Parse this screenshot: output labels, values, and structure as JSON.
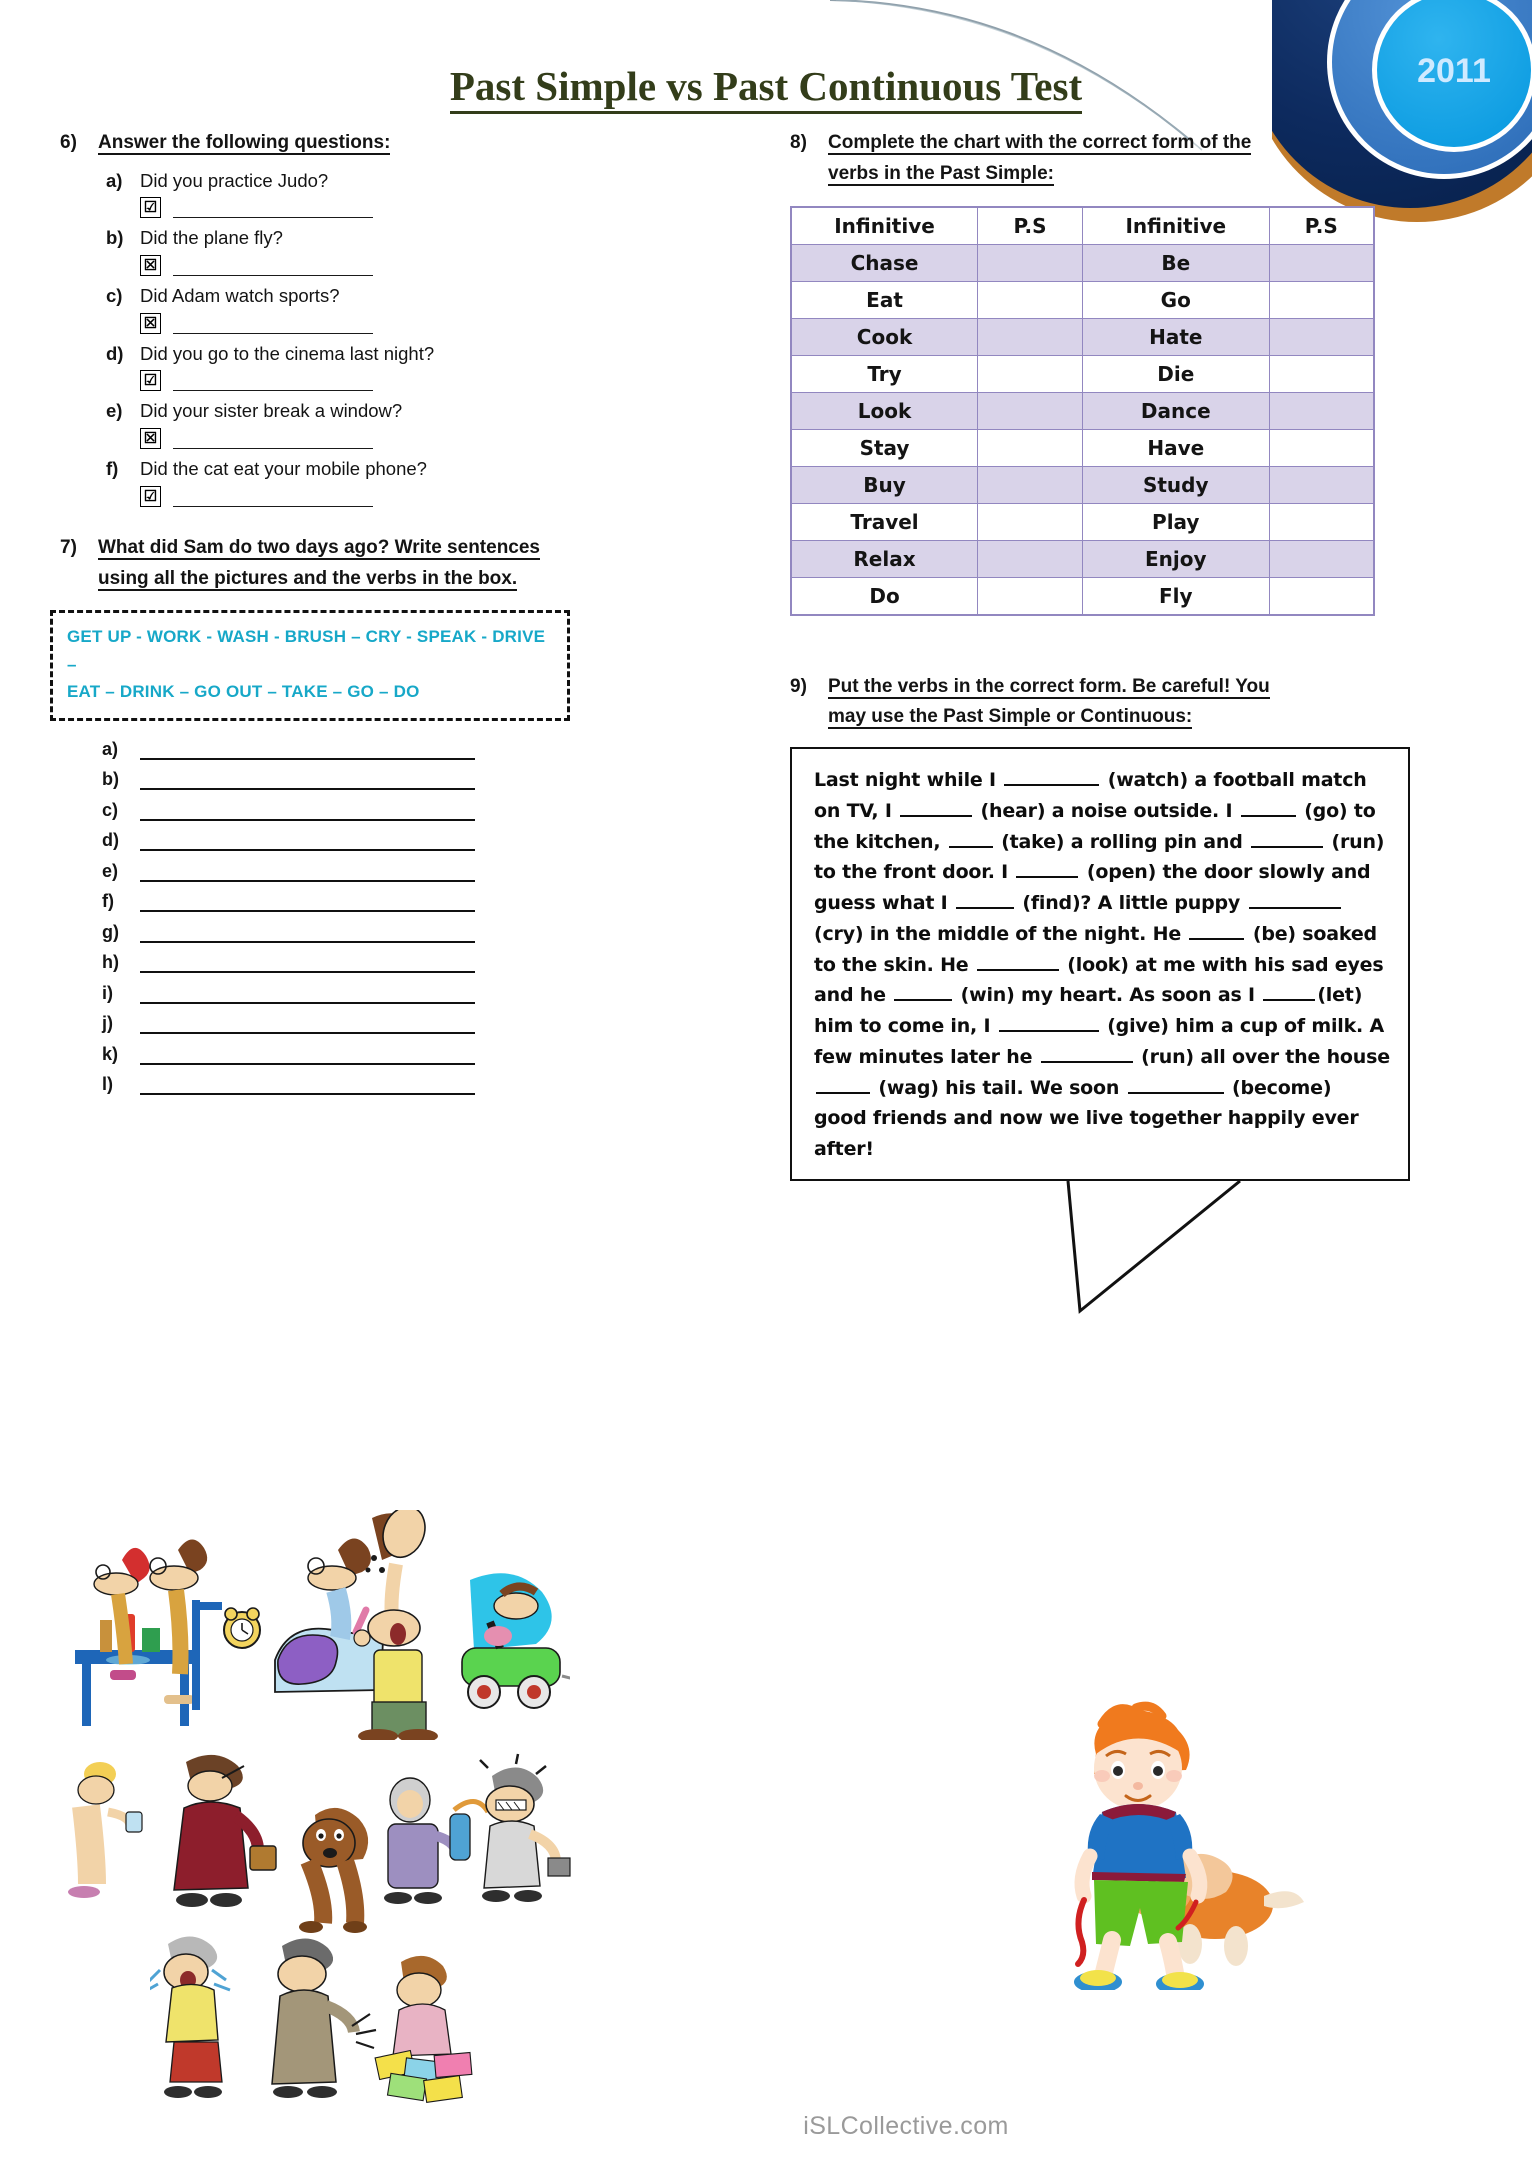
{
  "document": {
    "title": "Past Simple vs Past Continuous Test",
    "footer": "iSLCollective.com",
    "logo_year": "2011",
    "title_color": "#333d1a",
    "accent_cyan": "#17a8c8",
    "table_border": "#9287c0",
    "table_shade": "#d9d3e9"
  },
  "exercise6": {
    "number": "6)",
    "instruction": "Answer the following questions:",
    "questions": [
      {
        "letter": "a)",
        "text": "Did you practice Judo?",
        "mark": "☑"
      },
      {
        "letter": "b)",
        "text": "Did the plane fly?",
        "mark": "☒"
      },
      {
        "letter": "c)",
        "text": "Did Adam watch sports?",
        "mark": "☒"
      },
      {
        "letter": "d)",
        "text": "Did you go to the cinema last night?",
        "mark": "☑"
      },
      {
        "letter": "e)",
        "text": "Did your sister break a window?",
        "mark": "☒"
      },
      {
        "letter": "f)",
        "text": "Did the cat eat your mobile phone?",
        "mark": "☑"
      }
    ]
  },
  "exercise7": {
    "number": "7)",
    "instruction_line1": "What did Sam do two days ago? Write sentences",
    "instruction_line2": "using all the pictures and the verbs in the box.",
    "verb_box_line1": "GET UP  -  WORK  -  WASH -  BRUSH – CRY - SPEAK  - DRIVE –",
    "verb_box_line2": "EAT – DRINK – GO OUT – TAKE – GO – DO",
    "answer_letters": [
      "a)",
      "b)",
      "c)",
      "d)",
      "e)",
      "f)",
      "g)",
      "h)",
      "i)",
      "j)",
      "k)",
      "l)"
    ]
  },
  "exercise8": {
    "number": "8)",
    "instruction_line1": "Complete the chart with the correct form of the",
    "instruction_line2": "verbs in the Past Simple:",
    "headers": [
      "Infinitive",
      "P.S",
      "Infinitive",
      "P.S"
    ],
    "rows": [
      {
        "left": "Chase",
        "left_ps": "",
        "right": "Be",
        "right_ps": ""
      },
      {
        "left": "Eat",
        "left_ps": "",
        "right": "Go",
        "right_ps": ""
      },
      {
        "left": "Cook",
        "left_ps": "",
        "right": "Hate",
        "right_ps": ""
      },
      {
        "left": "Try",
        "left_ps": "",
        "right": "Die",
        "right_ps": ""
      },
      {
        "left": "Look",
        "left_ps": "",
        "right": "Dance",
        "right_ps": ""
      },
      {
        "left": "Stay",
        "left_ps": "",
        "right": "Have",
        "right_ps": ""
      },
      {
        "left": "Buy",
        "left_ps": "",
        "right": "Study",
        "right_ps": ""
      },
      {
        "left": "Travel",
        "left_ps": "",
        "right": "Play",
        "right_ps": ""
      },
      {
        "left": "Relax",
        "left_ps": "",
        "right": "Enjoy",
        "right_ps": ""
      },
      {
        "left": "Do",
        "left_ps": "",
        "right": "Fly",
        "right_ps": ""
      }
    ]
  },
  "exercise9": {
    "number": "9)",
    "instruction_line1": "Put the verbs in the correct form. Be careful! You",
    "instruction_line2": "may use the Past Simple or Continuous:",
    "story_segments": [
      {
        "t": "Last night while I "
      },
      {
        "blank": 95
      },
      {
        "t": " (watch) a football match on TV, I "
      },
      {
        "blank": 72
      },
      {
        "t": " (hear) a noise outside. I "
      },
      {
        "blank": 55
      },
      {
        "t": " (go) to the kitchen, "
      },
      {
        "blank": 44
      },
      {
        "t": " (take) a rolling pin and "
      },
      {
        "blank": 72
      },
      {
        "t": " (run) to the front door. I "
      },
      {
        "blank": 62
      },
      {
        "t": " (open) the door slowly and guess what I "
      },
      {
        "blank": 58
      },
      {
        "t": " (find)? A little puppy "
      },
      {
        "blank": 92
      },
      {
        "t": " (cry) in the middle of the night. He "
      },
      {
        "blank": 55
      },
      {
        "t": " (be) soaked to the skin. He "
      },
      {
        "blank": 82
      },
      {
        "t": " (look) at me with his sad eyes and he "
      },
      {
        "blank": 58
      },
      {
        "t": " (win) my heart. As soon as I "
      },
      {
        "blank": 52
      },
      {
        "t": "(let) him to come in, I "
      },
      {
        "blank": 100
      },
      {
        "t": " (give) him a cup of milk. A few minutes later he "
      },
      {
        "blank": 92
      },
      {
        "t": " (run) all over the house "
      },
      {
        "blank": 54
      },
      {
        "t": " (wag) his tail. We soon "
      },
      {
        "blank": 96
      },
      {
        "t": " (become) good friends and now we live together happily ever after!"
      }
    ]
  }
}
